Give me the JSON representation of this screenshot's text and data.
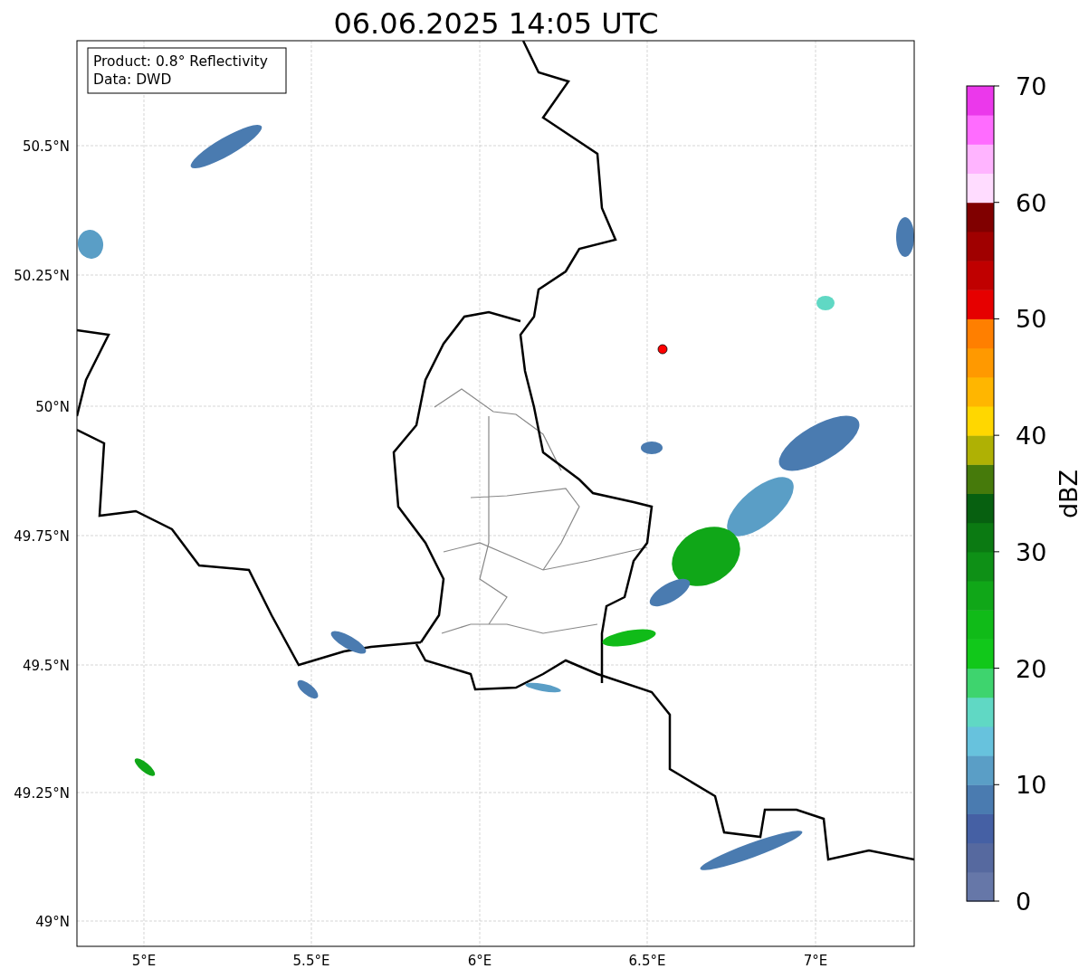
{
  "title": "06.06.2025 14:05 UTC",
  "info_box": [
    "Product: 0.8° Reflectivity",
    "Data: DWD"
  ],
  "x_ticks": [
    "5°E",
    "5.5°E",
    "6°E",
    "6.5°E",
    "7°E"
  ],
  "y_ticks": [
    "50.5°N",
    "50.25°N",
    "50°N",
    "49.75°N",
    "49.5°N",
    "49.25°N",
    "49°N"
  ],
  "colorbar": {
    "label": "dBZ",
    "ticks": [
      "70",
      "60",
      "50",
      "40",
      "30",
      "20",
      "10",
      "0"
    ],
    "segments": [
      {
        "color": "#6677a8"
      },
      {
        "color": "#56699f"
      },
      {
        "color": "#4560a4"
      },
      {
        "color": "#4a7bb0"
      },
      {
        "color": "#5a9ec6"
      },
      {
        "color": "#67c2dd"
      },
      {
        "color": "#60d8c4"
      },
      {
        "color": "#3ed46e"
      },
      {
        "color": "#11c81a"
      },
      {
        "color": "#10bb18"
      },
      {
        "color": "#10a718"
      },
      {
        "color": "#0e9016"
      },
      {
        "color": "#0b7a12"
      },
      {
        "color": "#076010"
      },
      {
        "color": "#467a0b"
      },
      {
        "color": "#afb104"
      },
      {
        "color": "#ffd700"
      },
      {
        "color": "#ffb600"
      },
      {
        "color": "#ff9900"
      },
      {
        "color": "#ff7f00"
      },
      {
        "color": "#e60000"
      },
      {
        "color": "#c00000"
      },
      {
        "color": "#a00000"
      },
      {
        "color": "#800000"
      },
      {
        "color": "#ffdcff"
      },
      {
        "color": "#ffb4ff"
      },
      {
        "color": "#ff6cff"
      },
      {
        "color": "#eb38eb"
      }
    ]
  }
}
